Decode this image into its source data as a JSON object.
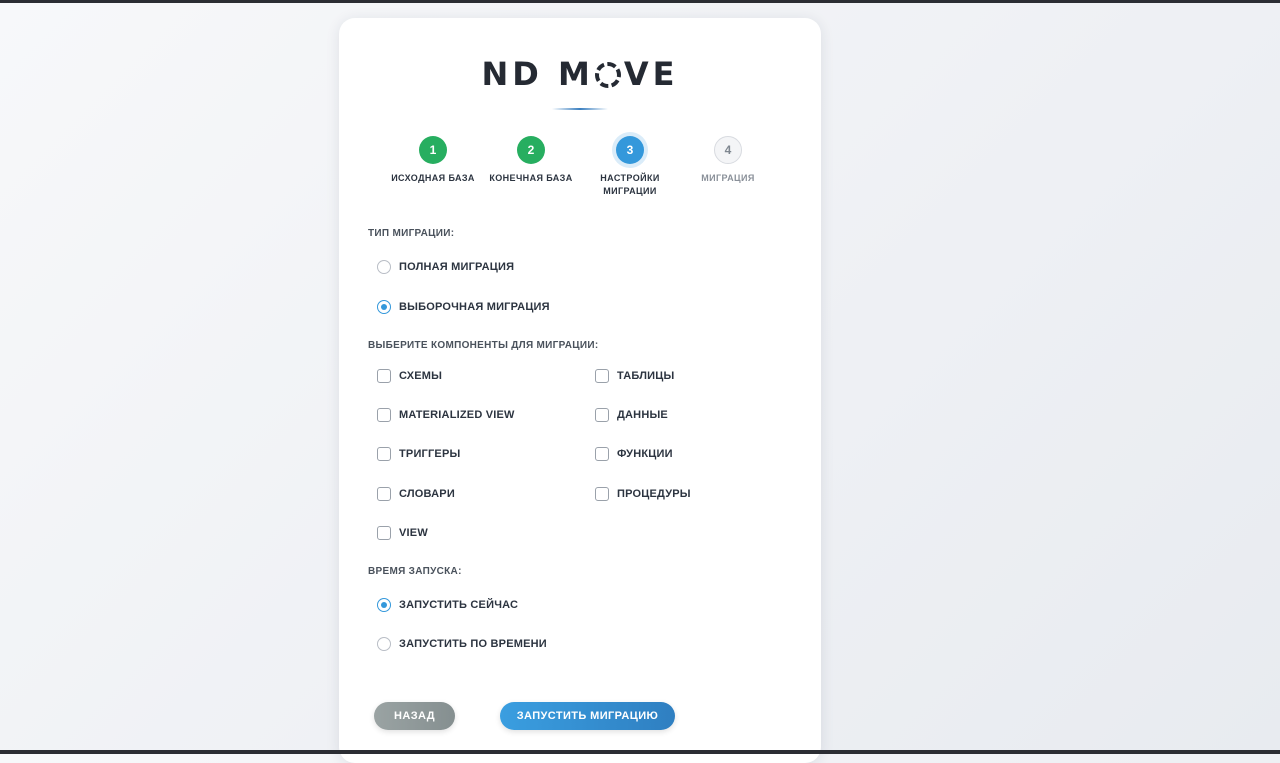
{
  "logo": {
    "left": "ND M",
    "right": "VE"
  },
  "steps": [
    {
      "number": "1",
      "label": "ИСХОДНАЯ БАЗА",
      "status": "done"
    },
    {
      "number": "2",
      "label": "КОНЕЧНАЯ БАЗА",
      "status": "done"
    },
    {
      "number": "3",
      "label": "НАСТРОЙКИ МИГРАЦИИ",
      "status": "active"
    },
    {
      "number": "4",
      "label": "МИГРАЦИЯ",
      "status": "pending"
    }
  ],
  "migration_type": {
    "label": "ТИП МИГРАЦИИ:",
    "options": [
      {
        "label": "ПОЛНАЯ МИГРАЦИЯ",
        "checked": false
      },
      {
        "label": "ВЫБОРОЧНАЯ МИГРАЦИЯ",
        "checked": true
      }
    ]
  },
  "components": {
    "label": "ВЫБЕРИТЕ КОМПОНЕНТЫ ДЛЯ МИГРАЦИИ:",
    "items": [
      {
        "label": "СХЕМЫ",
        "checked": false
      },
      {
        "label": "ТАБЛИЦЫ",
        "checked": false
      },
      {
        "label": "MATERIALIZED VIEW",
        "checked": false
      },
      {
        "label": "ДАННЫЕ",
        "checked": false
      },
      {
        "label": "ТРИГГЕРЫ",
        "checked": false
      },
      {
        "label": "ФУНКЦИИ",
        "checked": false
      },
      {
        "label": "СЛОВАРИ",
        "checked": false
      },
      {
        "label": "ПРОЦЕДУРЫ",
        "checked": false
      },
      {
        "label": "VIEW",
        "checked": false
      }
    ]
  },
  "launch_time": {
    "label": "ВРЕМЯ ЗАПУСКА:",
    "options": [
      {
        "label": "ЗАПУСТИТЬ СЕЙЧАС",
        "checked": true
      },
      {
        "label": "ЗАПУСТИТЬ ПО ВРЕМЕНИ",
        "checked": false
      }
    ]
  },
  "buttons": {
    "back": "НАЗАД",
    "start": "ЗАПУСТИТЬ МИГРАЦИЮ"
  },
  "colors": {
    "done": "#27ae60",
    "active": "#3498db",
    "pending": "#f4f5f7",
    "primary_button": "#2f8fd5",
    "secondary_button": "#8e9898"
  }
}
